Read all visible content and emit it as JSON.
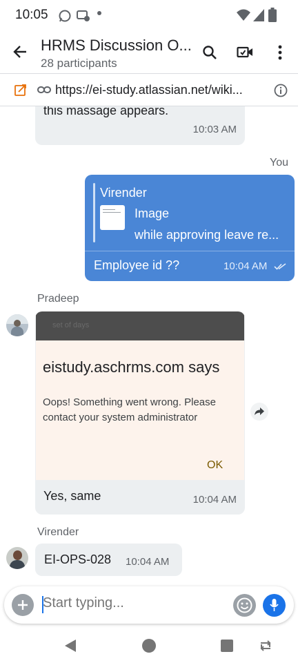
{
  "status_bar": {
    "time": "10:05"
  },
  "header": {
    "title": "HRMS Discussion O...",
    "subtitle": "28 participants",
    "back_icon": "arrow-back-icon",
    "actions": [
      "search-icon",
      "video-call-icon",
      "more-vert-icon"
    ]
  },
  "pinned": {
    "url": "https://ei-study.atlassian.net/wiki..."
  },
  "messages": {
    "partial": {
      "text": "this massage appears.",
      "time": "10:03 AM"
    },
    "mine": {
      "label": "You",
      "quote_author": "Virender",
      "quote_type": "Image",
      "quote_text": "while approving leave re...",
      "text": "Employee id ??",
      "time": "10:04 AM"
    },
    "pradeep": {
      "sender": "Pradeep",
      "dialog_header": "set of days",
      "dialog_title": "eistudy.aschrms.com says",
      "dialog_body": "Oops! Something went wrong. Please contact your system administrator",
      "dialog_ok": "OK",
      "caption": "Yes, same",
      "time": "10:04 AM"
    },
    "virender": {
      "sender": "Virender",
      "text": "EI-OPS-028",
      "time": "10:04 AM"
    }
  },
  "composer": {
    "placeholder": "Start typing..."
  },
  "colors": {
    "outgoing_bubble": "#4a86d6",
    "incoming_bubble": "#eceff1",
    "accent_blue": "#1a73e8",
    "link_orange": "#e8710a"
  }
}
